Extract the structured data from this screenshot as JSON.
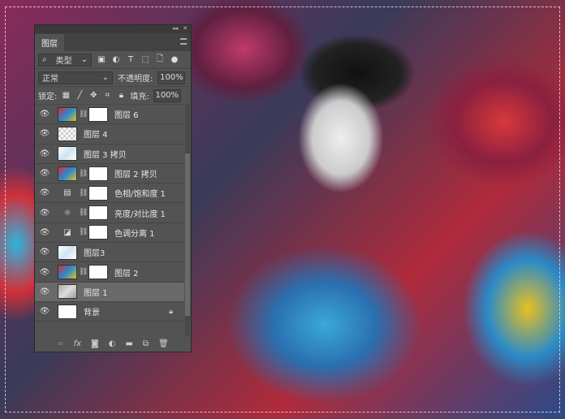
{
  "panel": {
    "tab": "图层",
    "collapse_label": "◂◂",
    "close_label": "✕",
    "filter": {
      "kind": "类型",
      "icons": [
        "image-filter",
        "adjustment-filter",
        "type-filter",
        "shape-filter",
        "smart-object-filter"
      ]
    },
    "blend_mode": "正常",
    "opacity_label": "不透明度:",
    "opacity": "100%",
    "lock_label": "锁定:",
    "fill_label": "填充:",
    "fill": "100%",
    "layers": [
      {
        "name": "图层 6",
        "thumb": "color",
        "mask": true
      },
      {
        "name": "图层 4",
        "thumb": "trans",
        "mask": false
      },
      {
        "name": "图层 3 拷贝",
        "thumb": "sketch",
        "mask": false
      },
      {
        "name": "图层 2 拷贝",
        "thumb": "color",
        "mask": "dark"
      },
      {
        "name": "色相/饱和度 1",
        "adj": "hue-saturation",
        "mask": true
      },
      {
        "name": "亮度/对比度 1",
        "adj": "brightness-contrast",
        "mask": true
      },
      {
        "name": "色调分离 1",
        "adj": "posterize",
        "mask": true
      },
      {
        "name": "图层3",
        "thumb": "sketch",
        "mask": false
      },
      {
        "name": "图层 2",
        "thumb": "color",
        "mask": "dark"
      },
      {
        "name": "图层 1",
        "thumb": "gray",
        "mask": false,
        "active": true
      },
      {
        "name": "背景",
        "thumb": "white",
        "mask": false,
        "locked": true
      }
    ],
    "footer": {
      "link": "∞",
      "fx": "fx"
    }
  }
}
